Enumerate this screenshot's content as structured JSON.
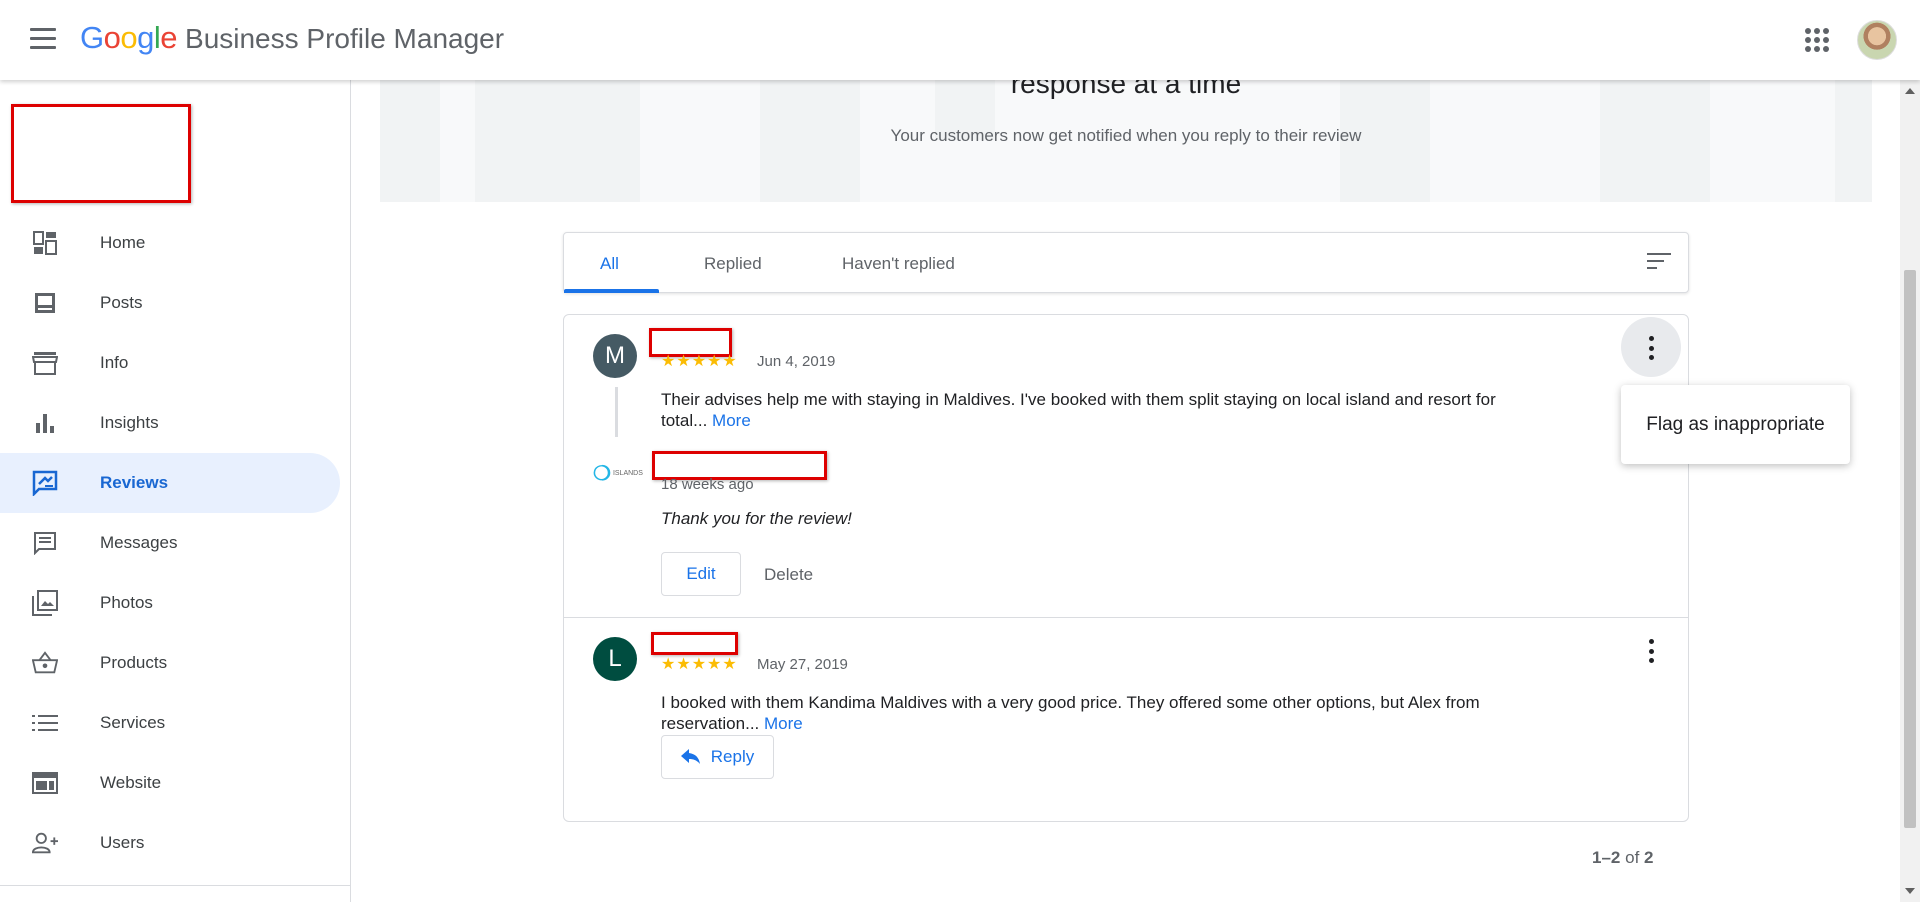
{
  "header": {
    "logo_letters": [
      {
        "ch": "G",
        "color": "#4285F4"
      },
      {
        "ch": "o",
        "color": "#EA4335"
      },
      {
        "ch": "o",
        "color": "#FBBC05"
      },
      {
        "ch": "g",
        "color": "#4285F4"
      },
      {
        "ch": "l",
        "color": "#34A853"
      },
      {
        "ch": "e",
        "color": "#EA4335"
      }
    ],
    "product_name": "Business Profile Manager"
  },
  "sidebar": {
    "items": [
      {
        "label": "Home",
        "icon": "dashboard-icon"
      },
      {
        "label": "Posts",
        "icon": "posts-icon"
      },
      {
        "label": "Info",
        "icon": "store-icon"
      },
      {
        "label": "Insights",
        "icon": "bar-chart-icon"
      },
      {
        "label": "Reviews",
        "icon": "rate-review-icon",
        "active": true
      },
      {
        "label": "Messages",
        "icon": "message-icon"
      },
      {
        "label": "Photos",
        "icon": "photos-icon"
      },
      {
        "label": "Products",
        "icon": "basket-icon"
      },
      {
        "label": "Services",
        "icon": "list-icon"
      },
      {
        "label": "Website",
        "icon": "web-icon"
      },
      {
        "label": "Users",
        "icon": "person-add-icon"
      }
    ]
  },
  "banner": {
    "title": "response at a time",
    "subtitle": "Your customers now get notified when you reply to their review"
  },
  "tabs": [
    {
      "label": "All",
      "active": true
    },
    {
      "label": "Replied"
    },
    {
      "label": "Haven't replied"
    }
  ],
  "reviews": [
    {
      "avatar_letter": "M",
      "avatar_color": "#455a64",
      "stars": "★★★★★",
      "date": "Jun 4, 2019",
      "text_line1": "Their advises help me with staying in Maldives. I've booked with them split staying on local island and resort for",
      "text_line2": "total...",
      "more_label": "More",
      "reply": {
        "logo_text": "ISLANDS",
        "time": "18 weeks ago",
        "text": "Thank you for the review!",
        "edit_label": "Edit",
        "delete_label": "Delete"
      }
    },
    {
      "avatar_letter": "L",
      "avatar_color": "#004d40",
      "stars": "★★★★★",
      "date": "May 27, 2019",
      "text_line1": "I booked with them Kandima Maldives with a very good price. They offered some other options, but Alex from",
      "text_line2": "reservation...",
      "more_label": "More",
      "reply_label": "Reply"
    }
  ],
  "menu_popup": {
    "item": "Flag as inappropriate"
  },
  "pagination": {
    "range": "1–2",
    "of_label": "of",
    "total": "2"
  }
}
